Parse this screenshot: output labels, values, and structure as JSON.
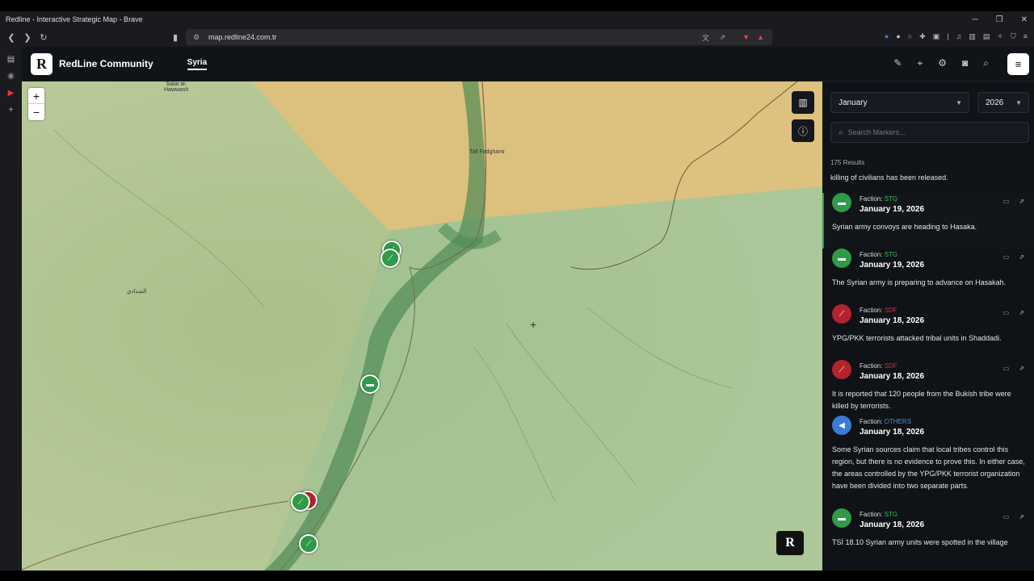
{
  "browser": {
    "window_title": "Redline - Interactive Strategic Map - Brave",
    "url": "map.redline24.com.tr"
  },
  "app": {
    "logo_letter": "R",
    "brand": "RedLine Community",
    "active_tab": "Syria"
  },
  "map": {
    "zoom_in": "+",
    "zoom_out": "−",
    "labels": {
      "hawwash": "Salat al-\nHawwash",
      "fadghami": "Tall Fadghami",
      "west": "ﺍﻟﺸﺪﺍﺩﻱ"
    },
    "badge": "R",
    "colors": {
      "sdf_zone": "#e3c07a",
      "gov_zone": "#8fbf95",
      "green_marker": "#2f9a47",
      "red_marker": "#b4232c",
      "blue_marker": "#3b7bd8"
    }
  },
  "panel": {
    "month": "January",
    "year": "2026",
    "search_placeholder": "Search Markers...",
    "results": "175 Results",
    "partial_text": "killing of civilians has been released.",
    "faction_prefix": "Faction: ",
    "entries": [
      {
        "faction": "STG",
        "date": "January 19, 2026",
        "text": "Syrian army convoys are heading to Hasaka.",
        "icon": "truck-icon",
        "color": "green"
      },
      {
        "faction": "STG",
        "date": "January 19, 2026",
        "text": "The Syrian army is preparing to advance on Hasakah.",
        "icon": "truck-icon",
        "color": "green"
      },
      {
        "faction": "SDF",
        "date": "January 18, 2026",
        "text": "YPG/PKK terrorists attacked tribal units in Shaddadi.",
        "icon": "rifle-icon",
        "color": "red"
      },
      {
        "faction": "SDF",
        "date": "January 18, 2026",
        "text": "It is reported that 120 people from the Bukish tribe were killed by terrorists.",
        "icon": "rifle-icon",
        "color": "red"
      },
      {
        "faction": "OTHERS",
        "date": "January 18, 2026",
        "text": "Some Syrian sources claim that local tribes control this region, but there is no evidence to prove this. In either case, the areas controlled by the YPG/PKK terrorist organization have been divided into two separate parts.",
        "icon": "megaphone-icon",
        "color": "blue"
      },
      {
        "faction": "STG",
        "date": "January 18, 2026",
        "text": "TSİ 18.10 Syrian army units were spotted in the village",
        "icon": "truck-icon",
        "color": "green"
      }
    ]
  }
}
